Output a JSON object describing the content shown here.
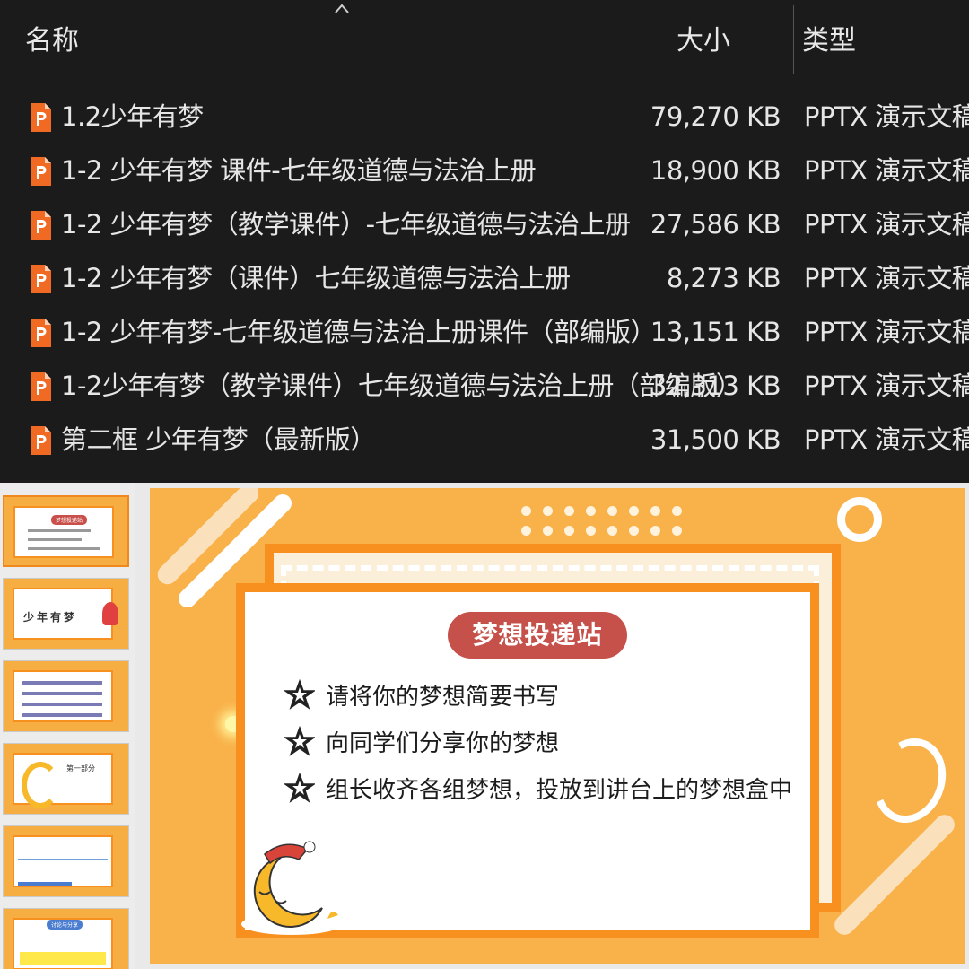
{
  "explorer": {
    "columns": {
      "name": "名称",
      "size": "大小",
      "type": "类型"
    },
    "files": [
      {
        "name": "1.2少年有梦",
        "size": "79,270 KB",
        "type": "PPTX 演示文稿"
      },
      {
        "name": "1-2 少年有梦 课件-七年级道德与法治上册",
        "size": "18,900 KB",
        "type": "PPTX 演示文稿"
      },
      {
        "name": "1-2 少年有梦（教学课件）-七年级道德与法治上册",
        "size": "27,586 KB",
        "type": "PPTX 演示文稿"
      },
      {
        "name": "1-2 少年有梦（课件）七年级道德与法治上册",
        "size": "8,273 KB",
        "type": "PPTX 演示文稿"
      },
      {
        "name": "1-2 少年有梦-七年级道德与法治上册课件（部编版）",
        "size": "13,151 KB",
        "type": "PPTX 演示文稿"
      },
      {
        "name": "1-2少年有梦（教学课件）七年级道德与法治上册（部编版）",
        "size": "32,313 KB",
        "type": "PPTX 演示文稿"
      },
      {
        "name": "第二框 少年有梦（最新版）",
        "size": "31,500 KB",
        "type": "PPTX 演示文稿"
      }
    ],
    "icon": "pptx-file-icon",
    "icon_color": "#f06a24"
  },
  "slide": {
    "title": "梦想投递站",
    "bullets": [
      "请将你的梦想简要书写",
      "向同学们分享你的梦想",
      "组长收齐各组梦想，投放到讲台上的梦想盒中"
    ],
    "bg_color": "#f9b14a",
    "frame_color": "#f7901e",
    "pill_color": "#c6514b"
  },
  "thumbnails": [
    {
      "title": "梦想投递站",
      "selected": true
    },
    {
      "title": "少年有梦"
    },
    {
      "title": ""
    },
    {
      "title": "第一部分"
    },
    {
      "title": ""
    },
    {
      "title": "讨论与分享"
    }
  ]
}
